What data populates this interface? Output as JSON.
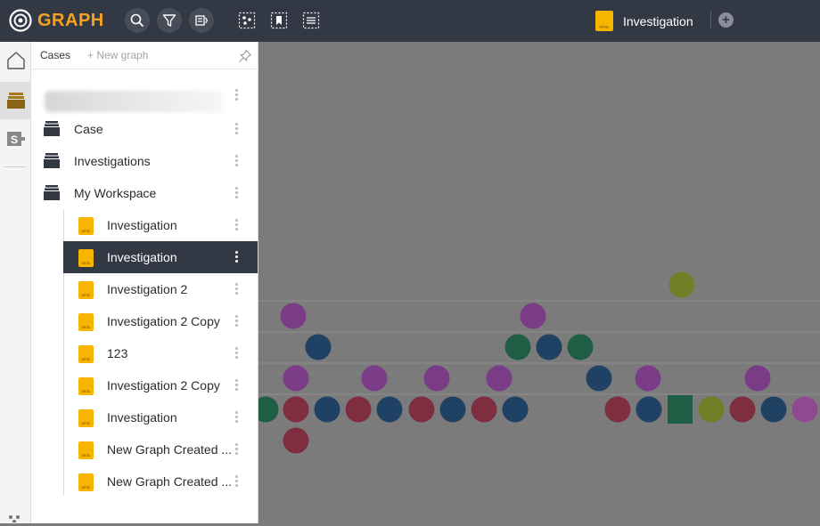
{
  "app": {
    "logo_text": "GRAPH"
  },
  "toolbar": {
    "search_icon": "search-icon",
    "filter_icon": "filter-icon",
    "layout_icon": "layout-icon",
    "select_icon": "select-nodes-icon",
    "bookmark_icon": "bookmark-select-icon",
    "list_icon": "list-select-icon"
  },
  "tabs": {
    "active_label": "Investigation",
    "add_icon": "plus-circle-icon",
    "add_glyph": "+"
  },
  "rail": {
    "items": [
      {
        "icon": "home-icon"
      },
      {
        "icon": "cases-folder-icon",
        "active": true
      },
      {
        "icon": "sql-icon"
      }
    ]
  },
  "panel": {
    "tab_cases": "Cases",
    "tab_new_graph": "+ New graph",
    "pin_icon": "pin-icon",
    "file_badge": "MTGL",
    "items": [
      {
        "label": "Case",
        "type": "folder"
      },
      {
        "label": "Investigations",
        "type": "folder"
      },
      {
        "label": "My Workspace",
        "type": "folder"
      },
      {
        "label": "Investigation",
        "type": "graph"
      },
      {
        "label": "Investigation",
        "type": "graph",
        "selected": true
      },
      {
        "label": "Investigation 2",
        "type": "graph"
      },
      {
        "label": "Investigation 2 Copy",
        "type": "graph"
      },
      {
        "label": "123",
        "type": "graph"
      },
      {
        "label": "Investigation 2 Copy",
        "type": "graph"
      },
      {
        "label": "Investigation",
        "type": "graph"
      },
      {
        "label": "New Graph Created ...",
        "type": "graph"
      },
      {
        "label": "New Graph Created ...",
        "type": "graph"
      }
    ]
  },
  "colors": {
    "topbar": "#333845",
    "accent": "#f7a21b",
    "node_olive": "#6f7f26",
    "node_purple": "#7a3b87",
    "node_blue": "#1f4264",
    "node_green": "#1f5e45",
    "node_red": "#7f2e3f",
    "node_magenta": "#8f4a8f",
    "edge": "#8f8f8f"
  }
}
